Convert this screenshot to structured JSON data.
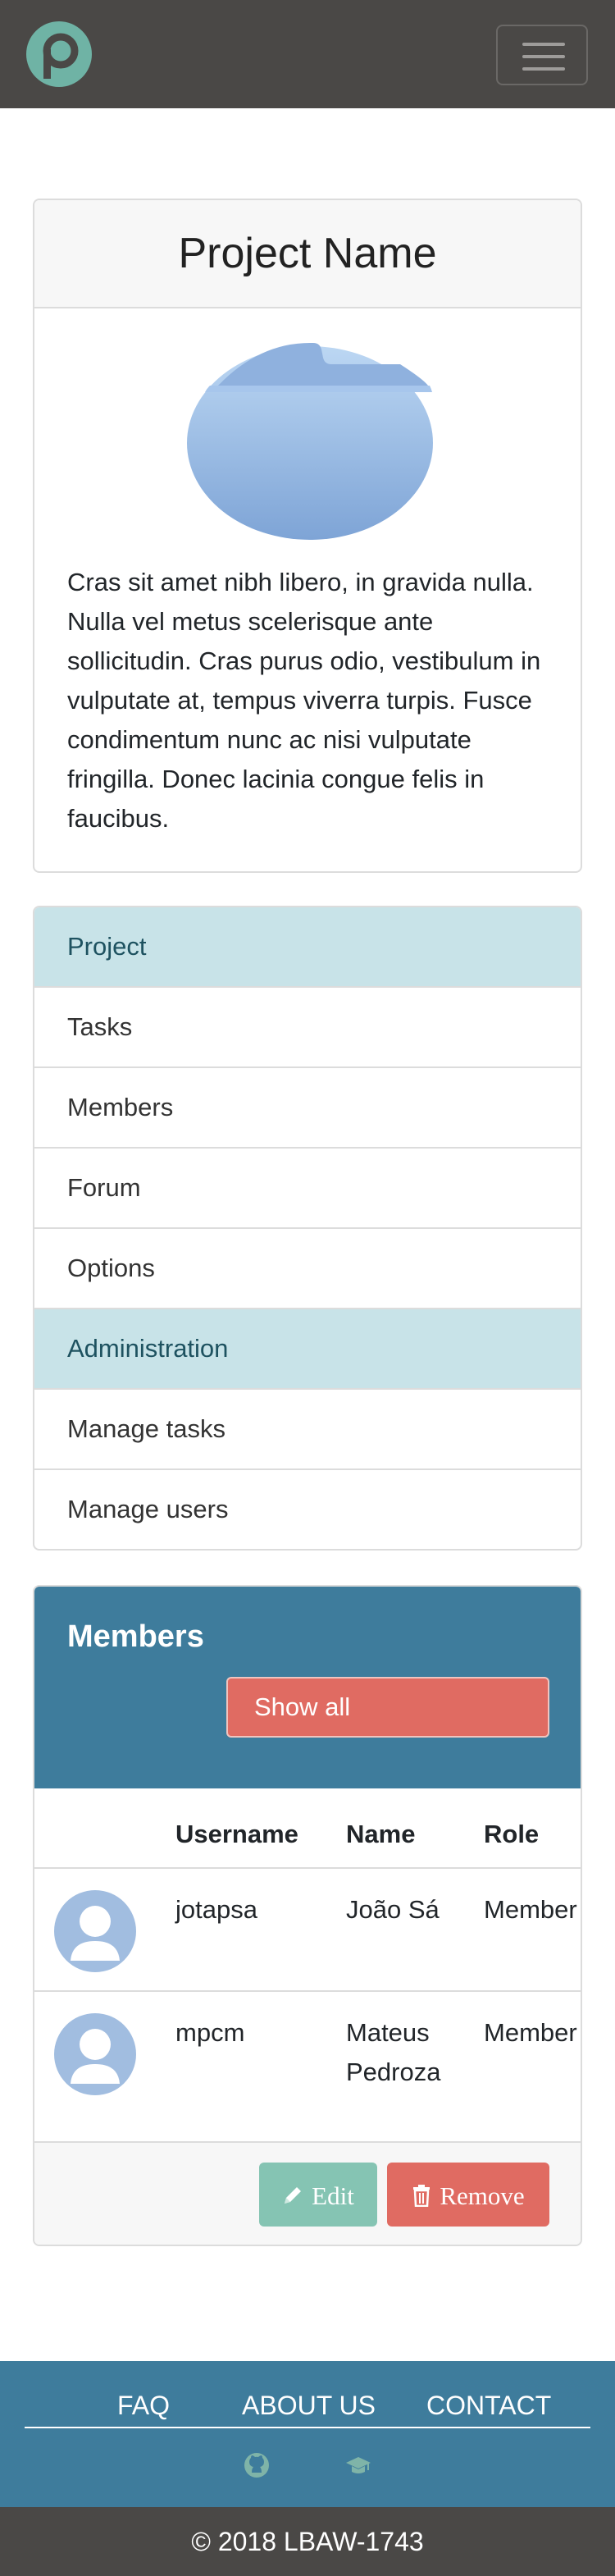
{
  "navbar": {
    "logo_icon": "p-logo-icon",
    "menu_icon": "hamburger-icon",
    "brand_color": "#6fb3a5"
  },
  "project": {
    "title": "Project Name",
    "image_icon": "folder-icon",
    "description": "Cras sit amet nibh libero, in gravida nulla. Nulla vel metus scelerisque ante sollicitudin. Cras purus odio, vestibulum in vulputate at, tempus viverra turpis. Fusce condimentum nunc ac nisi vulputate fringilla. Donec lacinia congue felis in faucibus."
  },
  "menu": {
    "items": [
      {
        "label": "Project",
        "active": true
      },
      {
        "label": "Tasks",
        "active": false
      },
      {
        "label": "Members",
        "active": false
      },
      {
        "label": "Forum",
        "active": false
      },
      {
        "label": "Options",
        "active": false
      },
      {
        "label": "Administration",
        "active": true
      },
      {
        "label": "Manage tasks",
        "active": false
      },
      {
        "label": "Manage users",
        "active": false
      }
    ]
  },
  "members": {
    "title": "Members",
    "show_all_label": "Show all",
    "columns": [
      "Username",
      "Name",
      "Role"
    ],
    "rows": [
      {
        "username": "jotapsa",
        "name_line1": "João Sá",
        "name_line2": "",
        "role": "Member"
      },
      {
        "username": "mpcm",
        "name_line1": "Mateus",
        "name_line2": "Pedroza",
        "role": "Member"
      }
    ],
    "edit_label": "Edit",
    "remove_label": "Remove",
    "edit_icon": "pencil-icon",
    "remove_icon": "trash-icon"
  },
  "footer": {
    "links": [
      "FAQ",
      "ABOUT US",
      "CONTACT"
    ],
    "icons": [
      "github-icon",
      "graduation-cap-icon"
    ],
    "copyright": "© 2018 LBAW-1743"
  },
  "colors": {
    "navbar_bg": "#4a4846",
    "accent_blue": "#3e7c9c",
    "danger": "#e06b62",
    "success": "#85c4b3",
    "active_item": "#c8e3e8"
  }
}
